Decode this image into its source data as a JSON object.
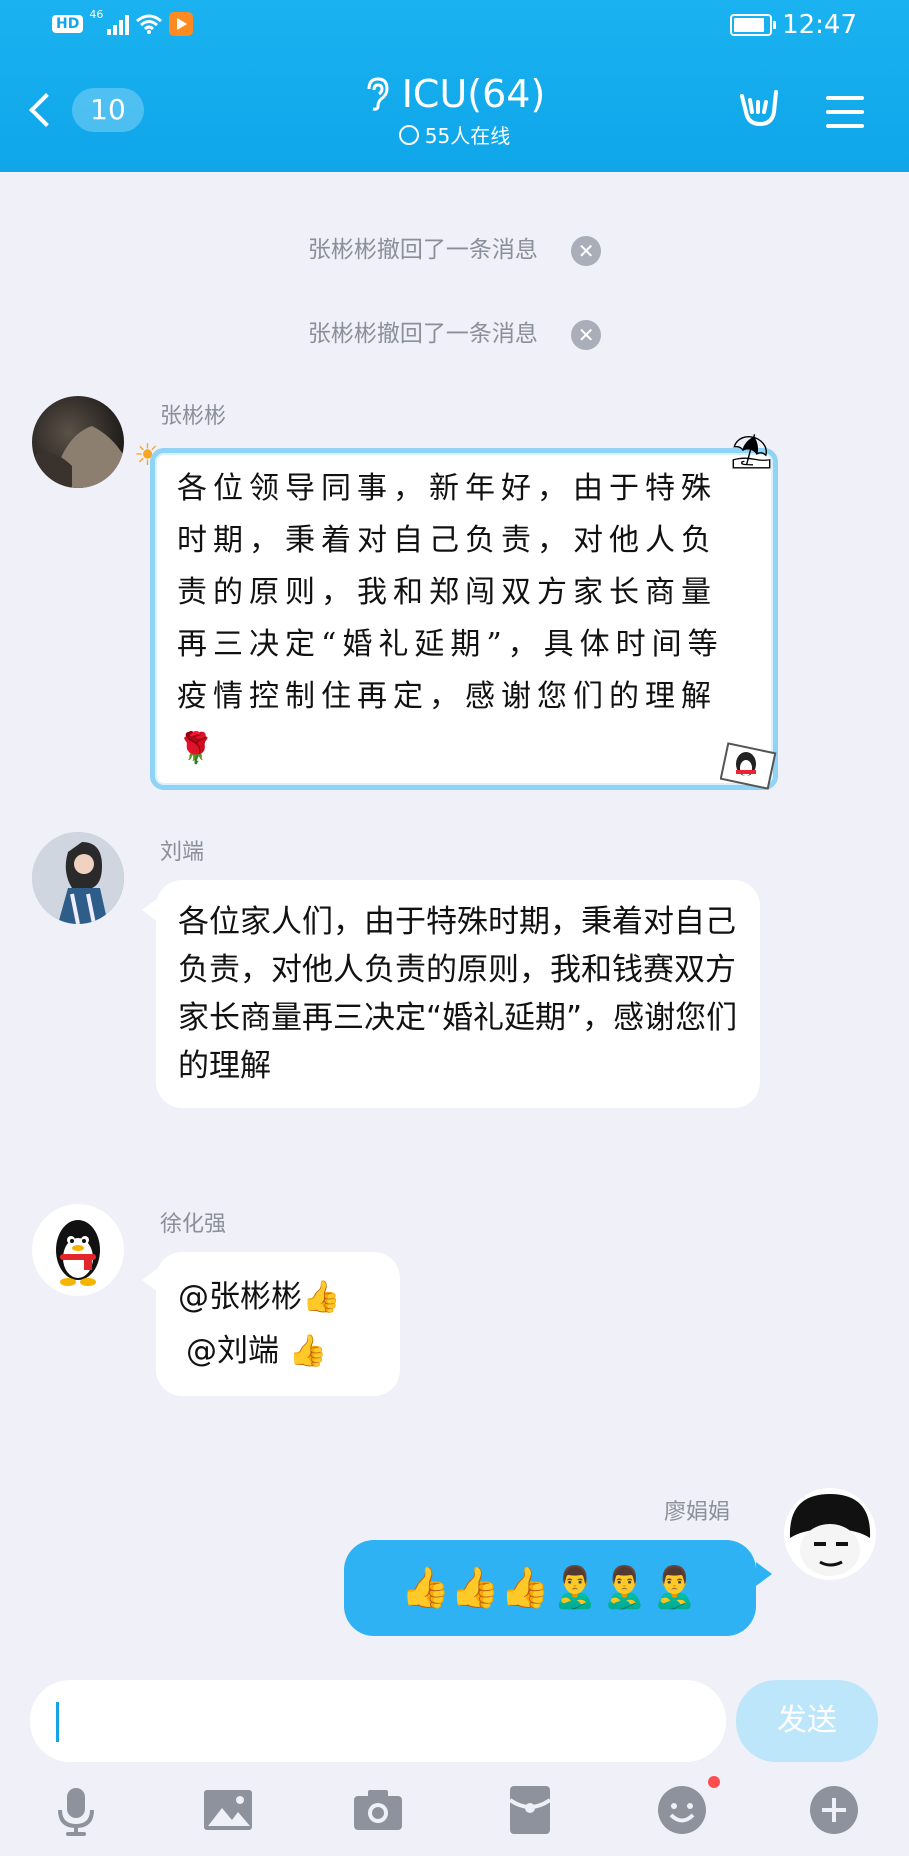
{
  "status_bar": {
    "time": "12:47",
    "hd": "HD",
    "net": "46"
  },
  "header": {
    "back_count": "10",
    "title": "ICU(64)",
    "online": "55人在线"
  },
  "system_messages": [
    "张彬彬撤回了一条消息",
    "张彬彬撤回了一条消息"
  ],
  "messages": [
    {
      "sender": "张彬彬",
      "text": "各位领导同事，新年好，由于特殊时期，秉着对自己负责，对他人负责的原则，我和郑闯双方家长商量再三决定“婚礼延期”，具体时间等疫情控制住再定，感谢您们的理解🌹"
    },
    {
      "sender": "刘端",
      "text": "各位家人们，由于特殊时期，秉着对自己负责，对他人负责的原则，我和钱赛双方家长商量再三决定“婚礼延期”，感谢您们的理解"
    },
    {
      "sender": "徐化强",
      "line1": "@张彬彬👍",
      "line2": "@刘端 👍"
    },
    {
      "sender": "廖娟娟",
      "emojis": "👍👍👍🙎‍♂️🙎‍♂️🙎‍♂️"
    }
  ],
  "input": {
    "placeholder": "",
    "send_label": "发送"
  },
  "colors": {
    "accent": "#12a7ea",
    "bubble_self": "#2fb2f3",
    "background": "#eff0f8"
  }
}
